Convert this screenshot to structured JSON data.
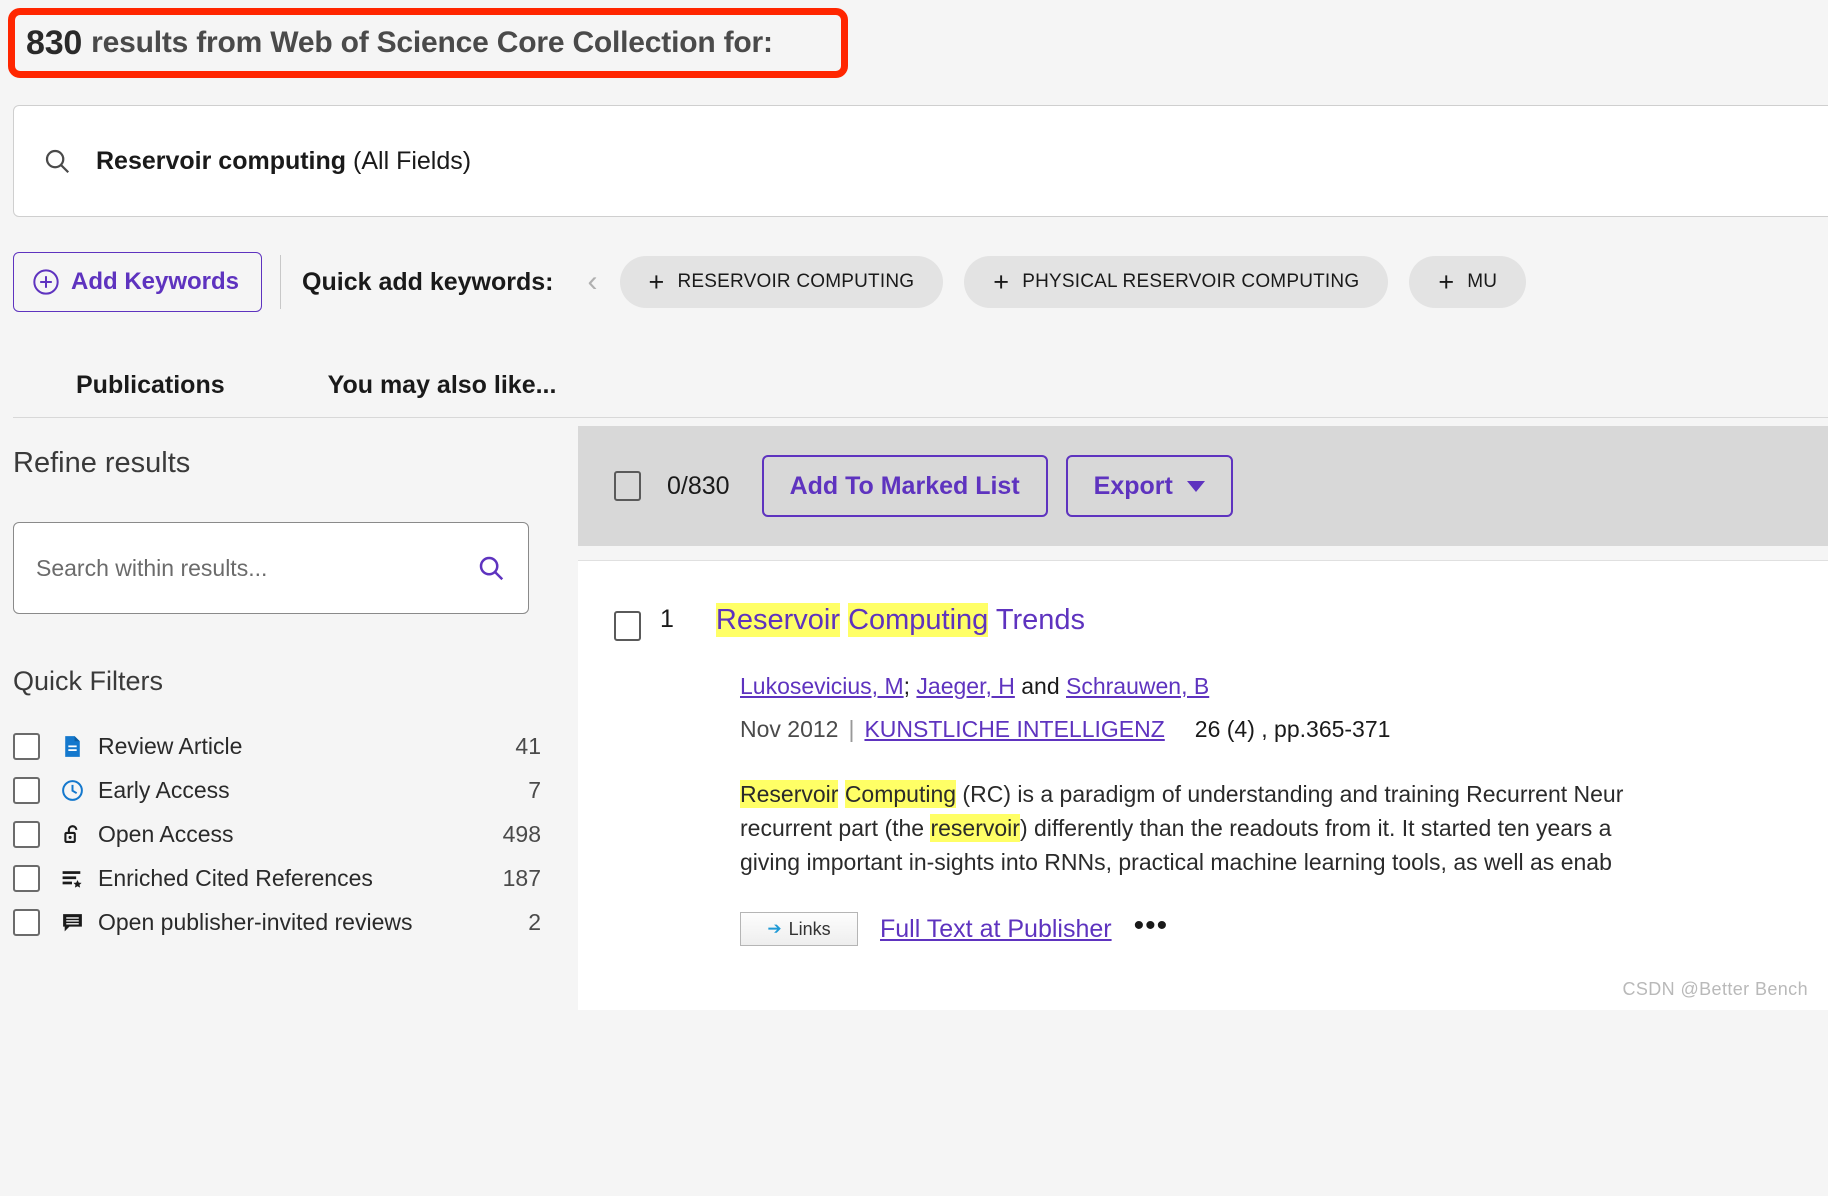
{
  "header": {
    "count": "830",
    "text": "results from Web of Science Core Collection for:",
    "annotation_color": "#ff2600"
  },
  "query": {
    "icon": "search-icon",
    "term": "Reservoir computing",
    "field": "(All Fields)"
  },
  "keywords_bar": {
    "add_keywords_label": "Add Keywords",
    "quick_add_label": "Quick add keywords:",
    "prev_arrow": "‹",
    "chips": [
      {
        "plus": "+",
        "label": "RESERVOIR COMPUTING"
      },
      {
        "plus": "+",
        "label": "PHYSICAL RESERVOIR COMPUTING"
      },
      {
        "plus": "+",
        "label": "MU"
      }
    ]
  },
  "tabs": [
    {
      "label": "Publications",
      "active": true
    },
    {
      "label": "You may also like...",
      "active": false
    }
  ],
  "sidebar": {
    "refine_title": "Refine results",
    "search_within": {
      "placeholder": "Search within results...",
      "value": "",
      "icon": "search-icon"
    },
    "quick_filters_title": "Quick Filters",
    "filters": [
      {
        "label": "Review Article",
        "count": "41",
        "icon": "document-icon",
        "icon_color": "#1478cd",
        "checked": false
      },
      {
        "label": "Early Access",
        "count": "7",
        "icon": "clock-icon",
        "icon_color": "#1478cd",
        "checked": false
      },
      {
        "label": "Open Access",
        "count": "498",
        "icon": "unlock-icon",
        "icon_color": "#1a1a1a",
        "checked": false
      },
      {
        "label": "Enriched Cited References",
        "count": "187",
        "icon": "list-star-icon",
        "icon_color": "#1a1a1a",
        "checked": false
      },
      {
        "label": "Open publisher-invited reviews",
        "count": "2",
        "icon": "comment-icon",
        "icon_color": "#1a1a1a",
        "checked": false
      }
    ]
  },
  "toolbar": {
    "selected_count": "0/830",
    "add_to_marked_list": "Add To Marked List",
    "export_label": "Export"
  },
  "results": [
    {
      "index": "1",
      "title_parts": [
        {
          "text": "Reservoir",
          "highlight": true
        },
        {
          "text": " ",
          "highlight": false
        },
        {
          "text": "Computing",
          "highlight": true
        },
        {
          "text": " Trends",
          "highlight": false
        }
      ],
      "authors": [
        {
          "name": "Lukosevicius, M",
          "link": true
        },
        {
          "name": "; ",
          "link": false
        },
        {
          "name": "Jaeger, H",
          "link": true
        },
        {
          "name": " and ",
          "link": false
        },
        {
          "name": "Schrauwen, B",
          "link": true
        }
      ],
      "date": "Nov 2012",
      "journal": "KUNSTLICHE INTELLIGENZ",
      "citation": "26 (4) , pp.365-371",
      "abstract_lines": [
        [
          {
            "text": "Reservoir",
            "highlight": true
          },
          {
            "text": " ",
            "highlight": false
          },
          {
            "text": "Computing",
            "highlight": true
          },
          {
            "text": " (RC) is a paradigm of understanding and training Recurrent Neur",
            "highlight": false
          }
        ],
        [
          {
            "text": "recurrent part (the ",
            "highlight": false
          },
          {
            "text": "reservoir",
            "highlight": true
          },
          {
            "text": ") differently than the readouts from it. It started ten years a",
            "highlight": false
          }
        ],
        [
          {
            "text": "giving important in-sights into RNNs, practical machine learning tools, as well as enab",
            "highlight": false
          }
        ]
      ],
      "links_badge": "Links",
      "full_text_link": "Full Text at Publisher",
      "more_label": "•••"
    }
  ],
  "watermark": "CSDN @Better Bench"
}
